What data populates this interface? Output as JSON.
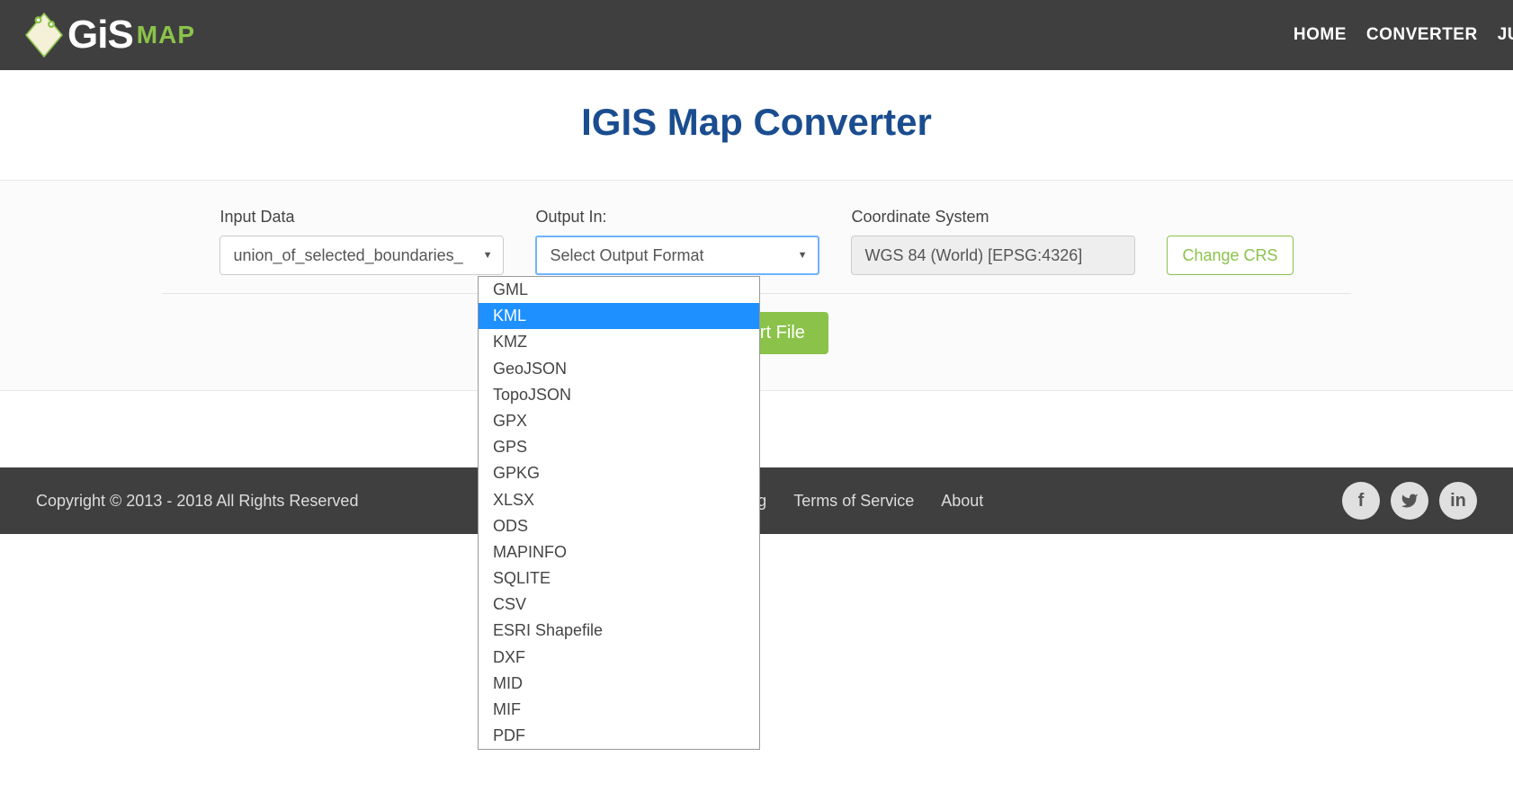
{
  "header": {
    "logo_main": "GiS",
    "logo_sub": "MAP",
    "nav": [
      "HOME",
      "CONVERTER",
      "JU"
    ]
  },
  "title": "IGIS Map Converter",
  "form": {
    "input_label": "Input Data",
    "input_value": "union_of_selected_boundaries_",
    "output_label": "Output In:",
    "output_placeholder": "Select Output Format",
    "output_options": [
      "GML",
      "KML",
      "KMZ",
      "GeoJSON",
      "TopoJSON",
      "GPX",
      "GPS",
      "GPKG",
      "XLSX",
      "ODS",
      "MAPINFO",
      "SQLITE",
      "CSV",
      "ESRI Shapefile",
      "DXF",
      "MID",
      "MIF",
      "PDF"
    ],
    "output_highlighted": "KML",
    "crs_label": "Coordinate System",
    "crs_value": "WGS 84 (World) [EPSG:4326]",
    "change_crs": "Change CRS",
    "convert": "Convert File"
  },
  "footer": {
    "copyright": "Copyright © 2013 - 2018 All Rights Reserved",
    "links": [
      "Pricing",
      "Terms of Service",
      "About"
    ],
    "social": [
      "f",
      "t",
      "in"
    ]
  }
}
